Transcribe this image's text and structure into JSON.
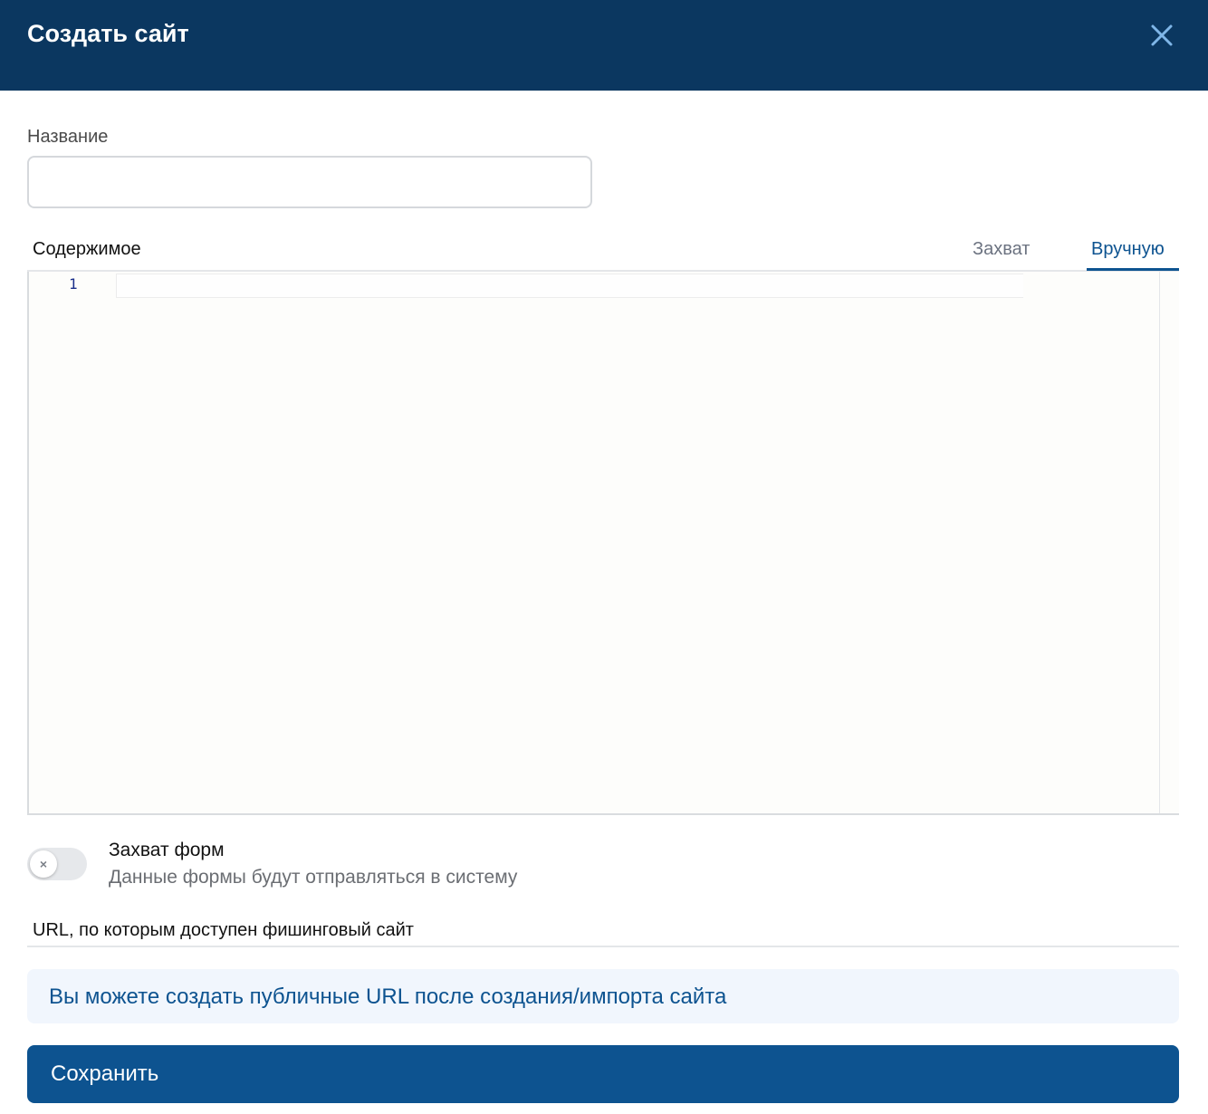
{
  "dialog": {
    "title": "Создать сайт",
    "close_icon": "close-icon"
  },
  "name_field": {
    "label": "Название",
    "value": "",
    "placeholder": ""
  },
  "content": {
    "label": "Содержимое",
    "tabs": [
      {
        "label": "Захват",
        "active": false
      },
      {
        "label": "Вручную",
        "active": true
      }
    ],
    "editor": {
      "line_numbers": [
        "1"
      ],
      "text": ""
    }
  },
  "form_capture": {
    "title": "Захват форм",
    "description": "Данные формы будут отправляться в систему",
    "enabled": false,
    "toggle_glyph": "×"
  },
  "urls": {
    "label": "URL, по которым доступен фишинговый сайт",
    "info": "Вы можете создать публичные URL после создания/импорта сайта"
  },
  "save_button": {
    "label": "Сохранить"
  },
  "colors": {
    "header_bg": "#0b3760",
    "accent": "#0d5390",
    "info_bg": "#f1f6fd"
  }
}
